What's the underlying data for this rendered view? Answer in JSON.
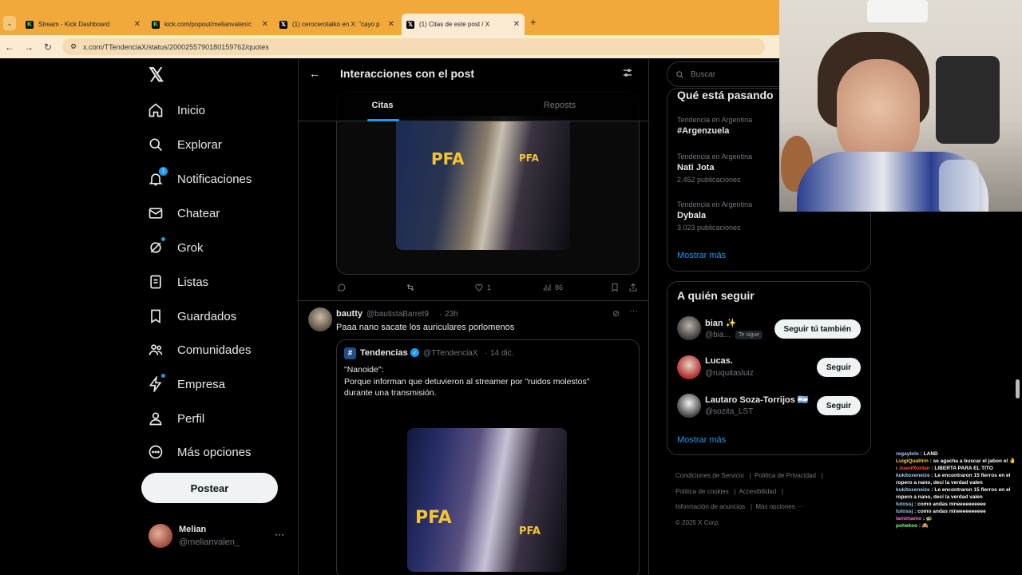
{
  "browser": {
    "tabs": [
      {
        "title": "Stream - Kick Dashboard",
        "icon": "kick-icon"
      },
      {
        "title": "kick.com/popout/melianvalen/c",
        "icon": "kick-icon"
      },
      {
        "title": "(1) cerocerotaiko en X: \"cayo p",
        "icon": "x-icon"
      },
      {
        "title": "(1) Citas de este post / X",
        "icon": "x-icon",
        "active": true
      }
    ],
    "url": "x.com/TTendenciaX/status/2000255790180159762/quotes",
    "new_tab": "+"
  },
  "nav": {
    "items": [
      {
        "label": "Inicio",
        "icon": "home-icon"
      },
      {
        "label": "Explorar",
        "icon": "search-icon"
      },
      {
        "label": "Notificaciones",
        "icon": "bell-icon",
        "badge": "1"
      },
      {
        "label": "Chatear",
        "icon": "mail-icon"
      },
      {
        "label": "Grok",
        "icon": "grok-icon"
      },
      {
        "label": "Listas",
        "icon": "list-icon"
      },
      {
        "label": "Guardados",
        "icon": "bookmark-icon"
      },
      {
        "label": "Comunidades",
        "icon": "people-icon"
      },
      {
        "label": "Empresa",
        "icon": "bolt-icon"
      },
      {
        "label": "Perfil",
        "icon": "person-icon"
      },
      {
        "label": "Más opciones",
        "icon": "more-circle-icon"
      }
    ],
    "post_button": "Postear",
    "account": {
      "name": "Melian",
      "handle": "@melianvalen_",
      "more": "···"
    }
  },
  "main": {
    "title": "Interacciones con el post",
    "tabs": [
      {
        "label": "Citas",
        "active": true
      },
      {
        "label": "Reposts"
      }
    ],
    "top_post": {
      "media_text": [
        "PFA",
        "PFA"
      ],
      "actions": {
        "reply": "",
        "repost": "",
        "like": "1",
        "views": "86"
      }
    },
    "post": {
      "author": "bautty",
      "handle": "@bautistaBarret9",
      "time": "23h",
      "text": "Paaa nano sacate los auriculares porlomenos",
      "quoted": {
        "author": "Tendencias",
        "handle": "@TTendenciaX",
        "date": "14 dic.",
        "line1": "\"Nanoide\":",
        "line2": "Porque informan que detuvieron al streamer por \"ruidos molestos\"",
        "line3": "durante una transmisión.",
        "media_text": [
          "PFA",
          "PFA"
        ]
      }
    }
  },
  "right": {
    "search_placeholder": "Buscar",
    "trends_title": "Qué está pasando",
    "trends": [
      {
        "category": "Tendencia en Argentina",
        "name": "#Argenzuela",
        "count": ""
      },
      {
        "category": "Tendencia en Argentina",
        "name": "Nati Jota",
        "count": "2.452 publicaciones"
      },
      {
        "category": "Tendencia en Argentina",
        "name": "Dybala",
        "count": "3.023 publicaciones"
      }
    ],
    "show_more": "Mostrar más",
    "follow_title": "A quién seguir",
    "follow": [
      {
        "name": "bian ✨",
        "handle": "@bia...",
        "tag": "Te sigue",
        "button": "Seguir tú también"
      },
      {
        "name": "Lucas.",
        "handle": "@ruquitasluiz",
        "button": "Seguir"
      },
      {
        "name": "Lautaro Soza-Torrijos 🇦🇷",
        "handle": "@sozita_LST",
        "button": "Seguir"
      }
    ],
    "show_more2": "Mostrar más",
    "footer": [
      "Condiciones de Servicio",
      "Política de Privacidad",
      "Política de cookies",
      "Accesibilidad",
      "Información de anuncios",
      "Más opciones ···",
      "© 2025 X Corp."
    ]
  },
  "chat": [
    {
      "user": "regaylolo",
      "color": "#9ad0ff",
      "msg": "LAND"
    },
    {
      "user": "LuigiQuattrin",
      "color": "#ffd24a",
      "msg": "se agacha a buscar el jabon el 🤚"
    },
    {
      "user": "JuaniRoldan",
      "color": "#ff4d4d",
      "msg": "LIBERTA PARA EL TITO",
      "prefix": "ı"
    },
    {
      "user": "kukitoxeneize",
      "color": "#9ad0ff",
      "msg": "Le encontraron 15 fierros en el ropero a nano, decí la verdad valen"
    },
    {
      "user": "kukitoxeneize",
      "color": "#9ad0ff",
      "msg": "Le encontraron 15 fierros en el ropero a nano, decí la verdad valen"
    },
    {
      "user": "tutossj",
      "color": "#9ad0ff",
      "msg": "como andas nineeeeeeeeee"
    },
    {
      "user": "tutossj",
      "color": "#9ad0ff",
      "msg": "como andas nineeeeeeeeee"
    },
    {
      "user": "lamimamo",
      "color": "#ff6ad5",
      "msg": "🐢"
    },
    {
      "user": "pohekoo",
      "color": "#7dff7d",
      "msg": "🙈"
    }
  ]
}
